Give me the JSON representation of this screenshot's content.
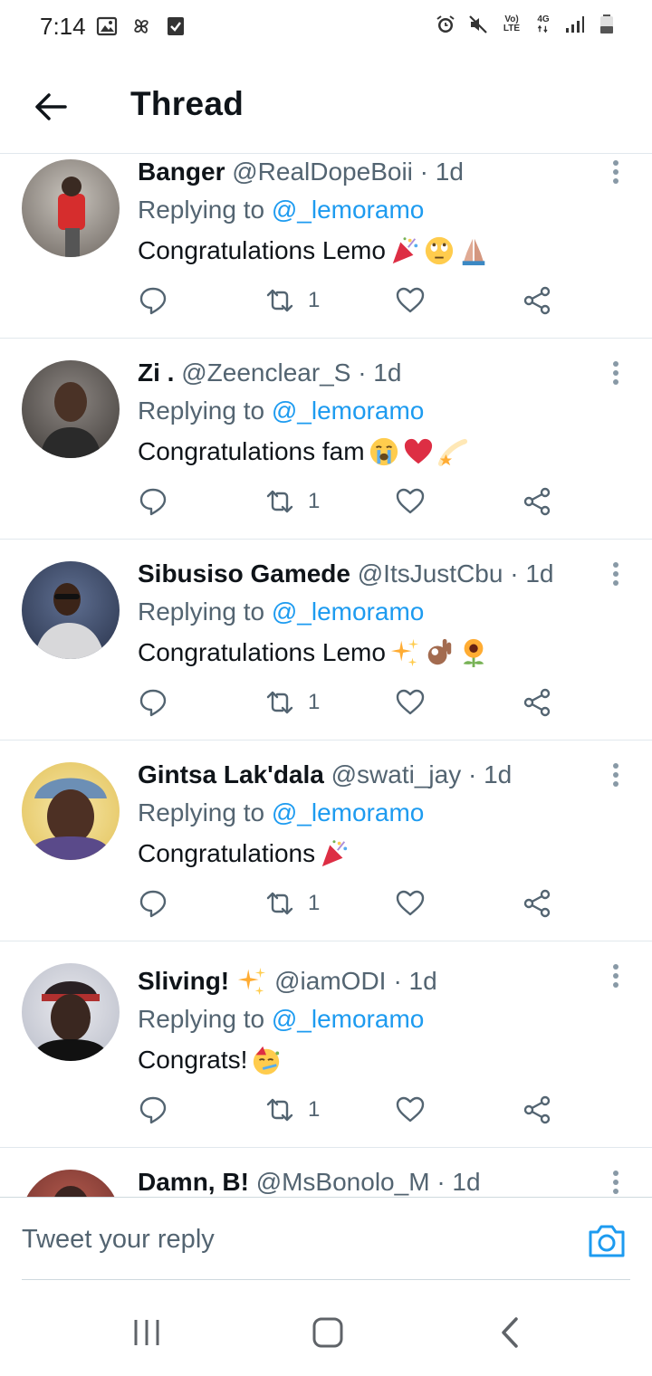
{
  "status_bar": {
    "time": "7:14",
    "left_icons": [
      "image-icon",
      "pinwheel-icon",
      "check-box-icon"
    ],
    "right_icons": [
      "alarm-icon",
      "mute-icon",
      "volte-icon",
      "4g-icon",
      "signal-icon",
      "battery-icon"
    ],
    "volte_top": "Vo)",
    "volte_bottom": "LTE",
    "net_top": "4G"
  },
  "header": {
    "title": "Thread"
  },
  "tweets": [
    {
      "name": "Banger",
      "handle": "@RealDopeBoii",
      "time": "· 1d",
      "replying_prefix": "Replying to",
      "replying_to": "@_lemoramo",
      "text": "Congratulations Lemo",
      "emojis": [
        "party-popper-emoji",
        "rolling-eyes-emoji",
        "folded-hands-emoji"
      ],
      "retweets": "1",
      "avatar_color": "#8a7f7a"
    },
    {
      "name": "Zi .",
      "handle": "@Zeenclear_S",
      "time": "· 1d",
      "replying_prefix": "Replying to",
      "replying_to": "@_lemoramo",
      "text": "Congratulations fam",
      "emojis": [
        "crying-face-emoji",
        "red-heart-emoji",
        "dizzy-star-emoji"
      ],
      "retweets": "1",
      "avatar_color": "#5a5552"
    },
    {
      "name": "Sibusiso Gamede",
      "handle": "@ItsJustCbu",
      "time": "· 1d",
      "replying_prefix": "Replying to",
      "replying_to": "@_lemoramo",
      "text": "Congratulations Lemo",
      "emojis": [
        "sparkles-emoji",
        "ok-hand-emoji",
        "sunflower-emoji"
      ],
      "retweets": "1",
      "avatar_color": "#3d4a63"
    },
    {
      "name": "Gintsa Lak'dala",
      "handle": "@swati_jay",
      "time": "· 1d",
      "replying_prefix": "Replying to",
      "replying_to": "@_lemoramo",
      "text": "Congratulations",
      "emojis": [
        "party-popper-emoji"
      ],
      "retweets": "1",
      "avatar_color": "#6b4a3a"
    },
    {
      "name": "Sliving!",
      "name_emoji": "sparkles-emoji",
      "handle": "@iamODI",
      "time": "· 1d",
      "replying_prefix": "Replying to",
      "replying_to": "@_lemoramo",
      "text": "Congrats!",
      "emojis": [
        "partying-face-emoji"
      ],
      "retweets": "1",
      "avatar_color": "#3b2d2a"
    },
    {
      "name": "Damn, B!",
      "handle": "@MsBonolo_M",
      "time": "· 1d",
      "avatar_color": "#8b3a3a"
    }
  ],
  "reply": {
    "placeholder": "Tweet your reply"
  },
  "nav": {
    "buttons": [
      "recents-icon",
      "home-icon",
      "back-icon"
    ]
  },
  "colors": {
    "accent": "#1d9bf0",
    "text": "#0f1419",
    "muted": "#536471",
    "divider": "#e1e8ed"
  }
}
